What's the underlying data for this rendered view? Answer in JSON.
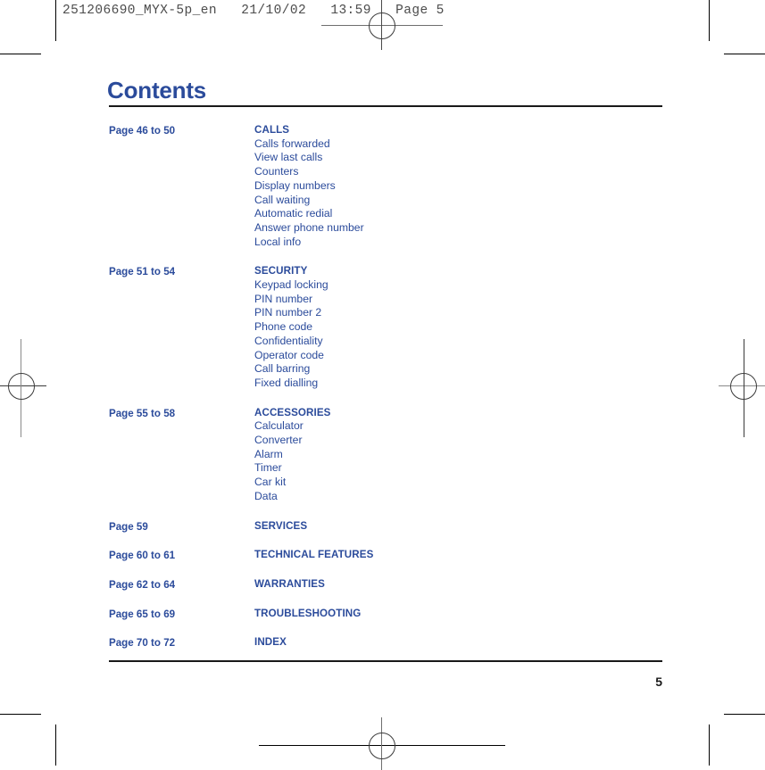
{
  "print_header": "251206690_MYX-5p_en   21/10/02   13:59   Page 5",
  "colors": {
    "brand_blue": "#2b4b9b",
    "rule_black": "#191919",
    "header_gray": "#4c4c4c"
  },
  "page": {
    "title": "Contents",
    "number": "5"
  },
  "toc": {
    "sections": [
      {
        "pages": "Page 46 to 50",
        "heading": "CALLS",
        "items": [
          "Calls forwarded",
          "View last calls",
          "Counters",
          "Display numbers",
          "Call waiting",
          "Automatic redial",
          "Answer phone number",
          "Local info"
        ]
      },
      {
        "pages": "Page 51 to 54",
        "heading": "SECURITY",
        "items": [
          "Keypad locking",
          "PIN number",
          "PIN number 2",
          "Phone code",
          "Confidentiality",
          "Operator code",
          "Call barring",
          "Fixed dialling"
        ]
      },
      {
        "pages": "Page 55 to 58",
        "heading": "ACCESSORIES",
        "items": [
          "Calculator",
          "Converter",
          "Alarm",
          "Timer",
          "Car kit",
          "Data"
        ]
      },
      {
        "pages": "Page 59",
        "heading": "SERVICES",
        "items": []
      },
      {
        "pages": "Page 60 to 61",
        "heading": "TECHNICAL FEATURES",
        "items": []
      },
      {
        "pages": "Page 62 to 64",
        "heading": "WARRANTIES",
        "items": []
      },
      {
        "pages": "Page 65 to 69",
        "heading": "TROUBLESHOOTING",
        "items": []
      },
      {
        "pages": "Page 70 to 72",
        "heading": "INDEX",
        "items": []
      }
    ]
  }
}
